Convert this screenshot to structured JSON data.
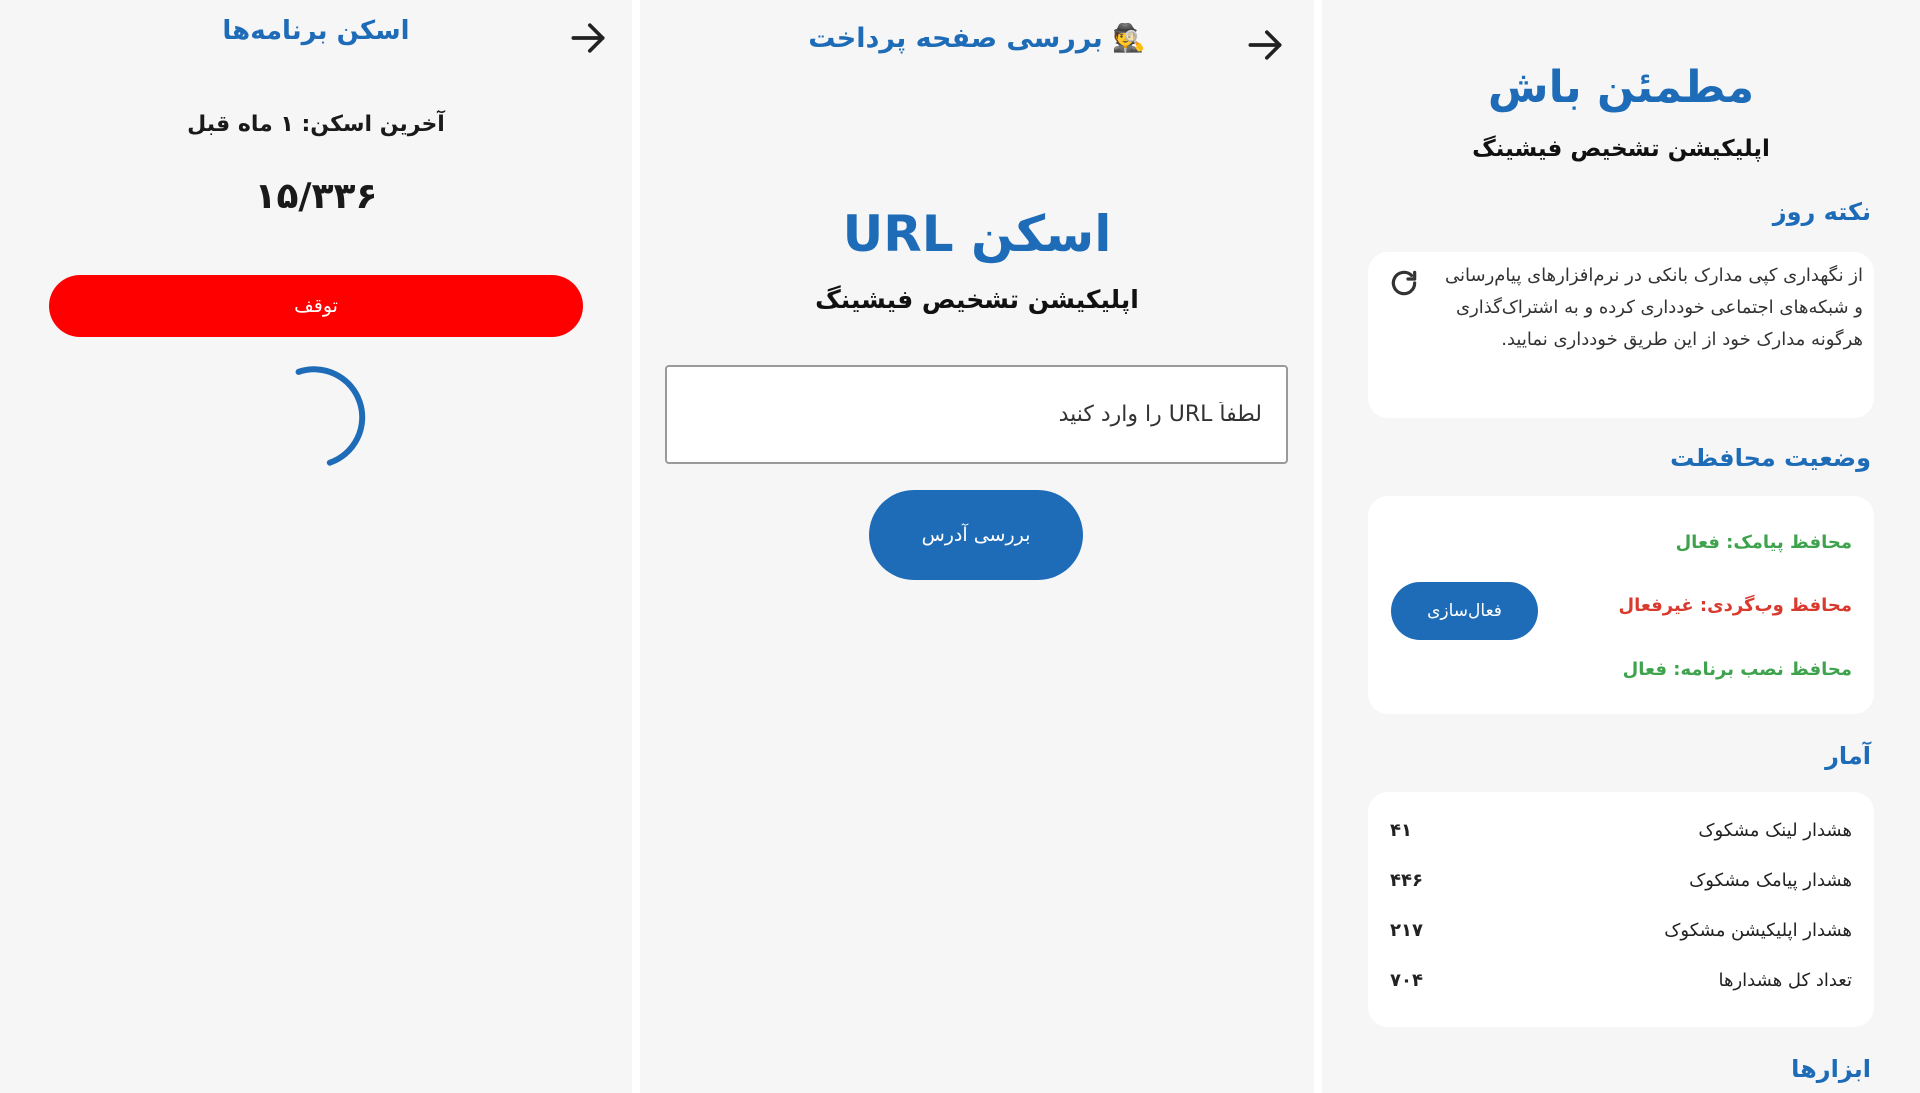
{
  "panel_scan_apps": {
    "title": "اسکن برنامه‌ها",
    "back_icon": "arrow-right-icon",
    "last_scan": "آخرین اسکن: ۱ ماه قبل",
    "progress_count": "۱۵/۳۳۶",
    "stop_label": "توقف",
    "stop_color": "#ff0000",
    "spinner_icon": "loading-spinner-icon"
  },
  "panel_url_scan": {
    "title": "🕵️ بررسی صفحه پرداخت",
    "back_icon": "arrow-right-icon",
    "heading": "اسکن URL",
    "subtitle": "اپلیکیشن تشخیص فیشینگ",
    "input_placeholder": "لطفاً URL را وارد کنید",
    "input_value": "",
    "check_label": "بررسی آدرس"
  },
  "panel_home": {
    "title": "مطمئن باش",
    "subtitle": "اپلیکیشن تشخیص فیشینگ",
    "tip_heading": "نکته روز",
    "tip_text": "از نگهداری کپی مدارک بانکی در نرم‌افزارهای پیام‌رسانی و شبکه‌های اجتماعی خودداری کرده و به اشتراک‌گذاری هرگونه مدارک خود از این طریق خودداری نمایید.",
    "refresh_icon": "refresh-icon",
    "protection_heading": "وضعیت محافظت",
    "protections": {
      "sms": "محافظ پیامک: فعال",
      "web": "محافظ وب‌گردی: غیرفعال",
      "app": "محافظ نصب برنامه: فعال"
    },
    "activate_label": "فعال‌سازی",
    "stats_heading": "آمار",
    "stats": [
      {
        "label": "هشدار لینک مشکوک",
        "value": "۴۱"
      },
      {
        "label": "هشدار پیامک مشکوک",
        "value": "۴۴۶"
      },
      {
        "label": "هشدار اپلیکیشن مشکوک",
        "value": "۲۱۷"
      },
      {
        "label": "تعداد کل هشدارها",
        "value": "۷۰۴"
      }
    ],
    "tools_heading": "ابزارها"
  },
  "colors": {
    "primary": "#1e6cb8",
    "active": "#3fa34d",
    "inactive": "#d83a2e",
    "panel_bg": "#f6f6f6"
  }
}
